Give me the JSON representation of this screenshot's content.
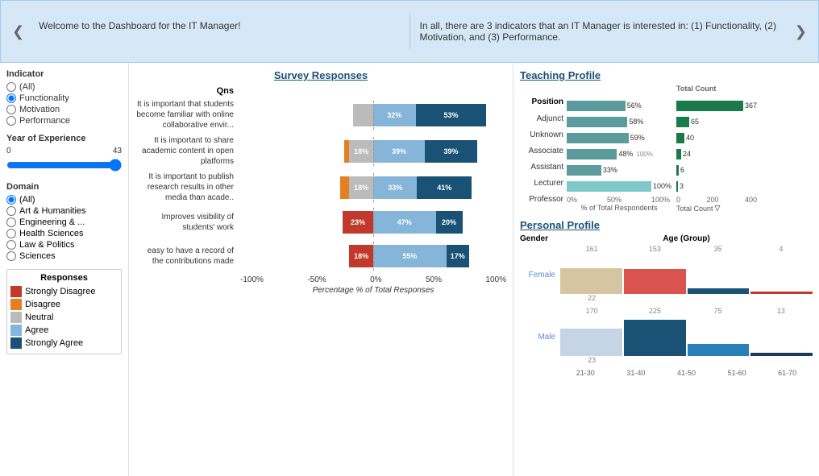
{
  "banner": {
    "left_text": "Welcome to the Dashboard for the IT Manager!",
    "right_text": "In all, there are 3 indicators that an IT Manager is interested in: (1) Functionality, (2) Motivation, and (3) Performance.",
    "prev_label": "❮",
    "next_label": "❯"
  },
  "filters": {
    "indicator_title": "Indicator",
    "indicator_options": [
      "(All)",
      "Functionality",
      "Motivation",
      "Performance"
    ],
    "indicator_selected": "Functionality",
    "experience_title": "Year of Experience",
    "exp_min": "0",
    "exp_max": "43",
    "domain_title": "Domain",
    "domain_options": [
      "(All)",
      "Art & Humanities",
      "Engineering & ...",
      "Health Sciences",
      "Law & Politics",
      "Sciences"
    ],
    "domain_selected": "(All)"
  },
  "legend": {
    "title": "Responses",
    "items": [
      {
        "label": "Strongly Disagree",
        "color": "#c0392b"
      },
      {
        "label": "Disagree",
        "color": "#e67e22"
      },
      {
        "label": "Neutral",
        "color": "#bbb"
      },
      {
        "label": "Agree",
        "color": "#85b5d9"
      },
      {
        "label": "Strongly Agree",
        "color": "#1a5276"
      }
    ]
  },
  "survey": {
    "title": "Survey Responses",
    "qns_label": "Qns",
    "questions": [
      {
        "text": "It is important that students become familiar with online collaborative envir...",
        "strongly_disagree": 0,
        "disagree": 0,
        "neutral": 15,
        "agree": 32,
        "strongly_agree": 53,
        "agree_label": "32%",
        "strongly_agree_label": "53%",
        "neutral_label": ""
      },
      {
        "text": "It is important to share academic content in open platforms",
        "strongly_disagree": 0,
        "disagree": 4,
        "neutral": 18,
        "agree": 39,
        "strongly_agree": 39,
        "disagree_label": "",
        "neutral_label": "18%",
        "agree_label": "39%",
        "strongly_agree_label": "39%"
      },
      {
        "text": "It is important to publish research results in other media than acade..",
        "strongly_disagree": 0,
        "disagree": 7,
        "neutral": 18,
        "agree": 33,
        "strongly_agree": 41,
        "neutral_label": "18%",
        "agree_label": "33%",
        "strongly_agree_label": "41%"
      },
      {
        "text": "Improves visibility of students' work",
        "strongly_disagree": 10,
        "disagree": 0,
        "neutral": 0,
        "agree": 47,
        "strongly_agree": 20,
        "sd_label": "23%",
        "agree_label": "47%",
        "strongly_agree_label": "20%"
      },
      {
        "text": "easy to have a record of the contributions made",
        "strongly_disagree": 9,
        "disagree": 0,
        "neutral": 0,
        "agree": 55,
        "strongly_agree": 17,
        "sd_label": "18%",
        "agree_label": "55%",
        "strongly_agree_label": "17%"
      }
    ],
    "x_labels": [
      "-100%",
      "-50%",
      "0%",
      "50%",
      "100%"
    ],
    "x_title": "Percentage % of Total Responses"
  },
  "teaching": {
    "title": "Teaching Profile",
    "position_label": "Position",
    "positions": [
      "Adjunct",
      "Unknown",
      "Associate",
      "Assistant",
      "Lecturer",
      "Professor"
    ],
    "pct_values": [
      56,
      58,
      59,
      48,
      33,
      100
    ],
    "pct_labels": [
      "56%",
      "58%",
      "59%",
      "48%",
      "33%",
      "100%"
    ],
    "counts": [
      367,
      65,
      40,
      24,
      6,
      3
    ],
    "x_labels_pct": [
      "0%",
      "50%",
      "100%"
    ],
    "x_title_pct": "% of Total Respondents",
    "x_labels_count": [
      "0",
      "200",
      "400"
    ],
    "x_title_count": "Total Count",
    "max_pct": 100,
    "max_count": 400
  },
  "personal": {
    "title": "Personal Profile",
    "gender_label": "Gender",
    "age_group_label": "Age (Group)",
    "genders": [
      {
        "label": "Female",
        "age_values": [
          161,
          153,
          35,
          4
        ],
        "bar_colors": [
          "#d5c5a0",
          "#d9534f",
          "#1a5276",
          "#c0392b"
        ],
        "bottom_values": [
          22,
          null,
          null,
          null
        ]
      },
      {
        "label": "Male",
        "age_values": [
          170,
          225,
          75,
          13
        ],
        "bar_colors": [
          "#c5d5e5",
          "#1a5276",
          "#2980b9",
          "#1a3a5c"
        ],
        "bottom_values": [
          23,
          null,
          null,
          null
        ]
      }
    ],
    "age_labels": [
      "21-30",
      "31-40",
      "41-50",
      "51-60",
      "61-70"
    ]
  }
}
